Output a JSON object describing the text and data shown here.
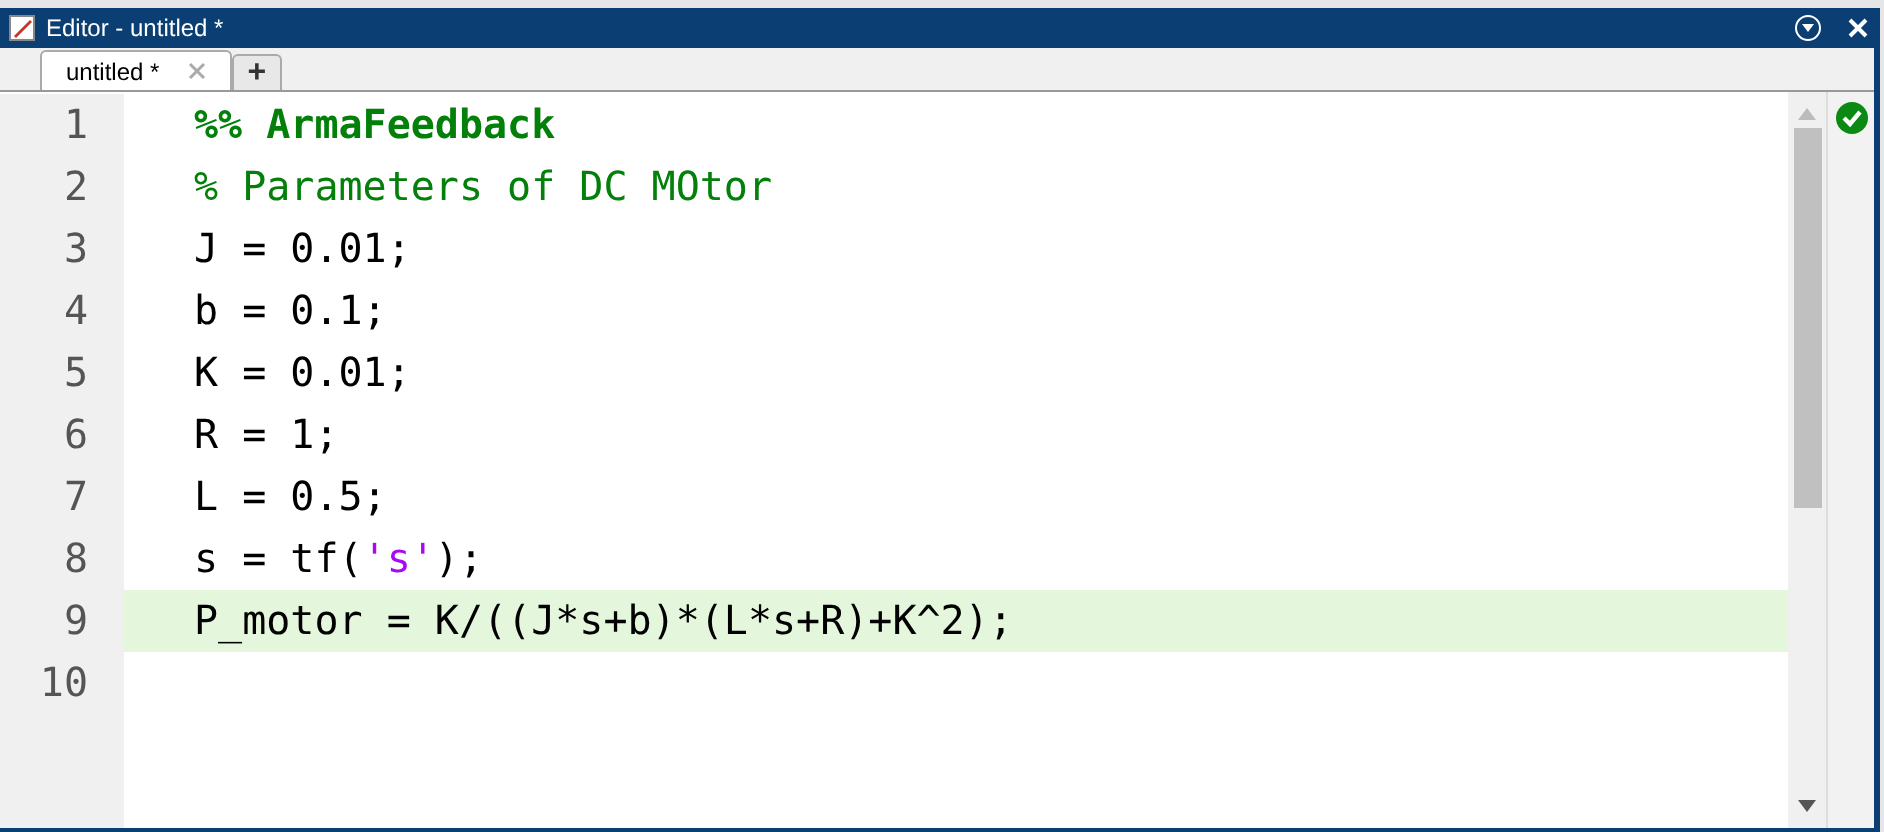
{
  "window": {
    "title": "Editor - untitled *"
  },
  "tabs": [
    {
      "label": "untitled *",
      "selected": true
    }
  ],
  "new_tab": {
    "label": "+"
  },
  "editor": {
    "lines": [
      {
        "number": "1",
        "current": false,
        "tokens": [
          {
            "kind": "cell",
            "text": "%% ArmaFeedback"
          }
        ]
      },
      {
        "number": "2",
        "current": false,
        "tokens": [
          {
            "kind": "comment",
            "text": "% Parameters of DC MOtor"
          }
        ]
      },
      {
        "number": "3",
        "current": false,
        "tokens": [
          {
            "kind": "code",
            "text": "J = 0.01;"
          }
        ]
      },
      {
        "number": "4",
        "current": false,
        "tokens": [
          {
            "kind": "code",
            "text": "b = 0.1;"
          }
        ]
      },
      {
        "number": "5",
        "current": false,
        "tokens": [
          {
            "kind": "code",
            "text": "K = 0.01;"
          }
        ]
      },
      {
        "number": "6",
        "current": false,
        "tokens": [
          {
            "kind": "code",
            "text": "R = 1;"
          }
        ]
      },
      {
        "number": "7",
        "current": false,
        "tokens": [
          {
            "kind": "code",
            "text": "L = 0.5;"
          }
        ]
      },
      {
        "number": "8",
        "current": false,
        "tokens": [
          {
            "kind": "code",
            "text": "s = tf("
          },
          {
            "kind": "string",
            "text": "'s'"
          },
          {
            "kind": "code",
            "text": ");"
          }
        ]
      },
      {
        "number": "9",
        "current": true,
        "tokens": [
          {
            "kind": "code",
            "text": "P_motor = K/((J*s+b)*(L*s+R)+K^2);"
          }
        ]
      },
      {
        "number": "10",
        "current": false
      }
    ]
  }
}
